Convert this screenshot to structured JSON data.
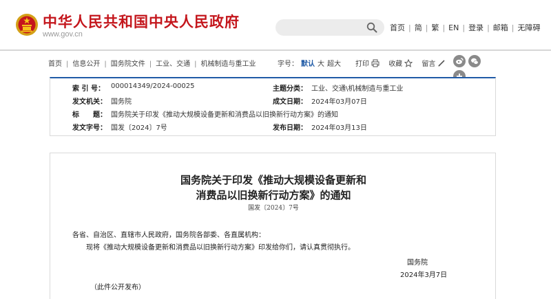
{
  "header": {
    "site_title": "中华人民共和国中央人民政府",
    "site_url": "www.gov.cn",
    "search_placeholder": "",
    "nav": [
      "首页",
      "简",
      "繁",
      "EN",
      "登录",
      "邮箱",
      "无障碍"
    ]
  },
  "breadcrumb": [
    "首页",
    "信息公开",
    "国务院文件",
    "工业、交通",
    "机械制造与重工业"
  ],
  "font_size": {
    "label": "字号：",
    "options": [
      "默认",
      "大",
      "超大"
    ],
    "selected": "默认"
  },
  "tools": {
    "print": "打印",
    "favorite": "收藏",
    "comment": "留言"
  },
  "share_icons": [
    "weibo-icon",
    "wechat-icon",
    "plus-icon"
  ],
  "info": {
    "index_label": "索 引 号：",
    "index_value": "000014349/2024-00025",
    "topic_label": "主题分类：",
    "topic_value": "工业、交通\\机械制造与重工业",
    "issuer_label": "发文机关：",
    "issuer_value": "国务院",
    "date_label": "成文日期：",
    "date_value": "2024年03月07日",
    "title_label": "标　　题：",
    "title_value": "国务院关于印发《推动大规模设备更新和消费品以旧换新行动方案》的通知",
    "docno_label": "发文字号：",
    "docno_value": "国发〔2024〕7号",
    "pubdate_label": "发布日期：",
    "pubdate_value": "2024年03月13日"
  },
  "article": {
    "title_line1": "国务院关于印发《推动大规模设备更新和",
    "title_line2": "消费品以旧换新行动方案》的通知",
    "doc_number": "国发〔2024〕7号",
    "salutation": "各省、自治区、直辖市人民政府，国务院各部委、各直属机构：",
    "body": "现将《推动大规模设备更新和消费品以旧换新行动方案》印发给你们，请认真贯彻执行。",
    "signature": "国务院",
    "sign_date": "2024年3月7日",
    "note": "（此件公开发布）"
  },
  "colors": {
    "brand_red": "#c4161c",
    "accent_blue": "#1f5aa6"
  }
}
